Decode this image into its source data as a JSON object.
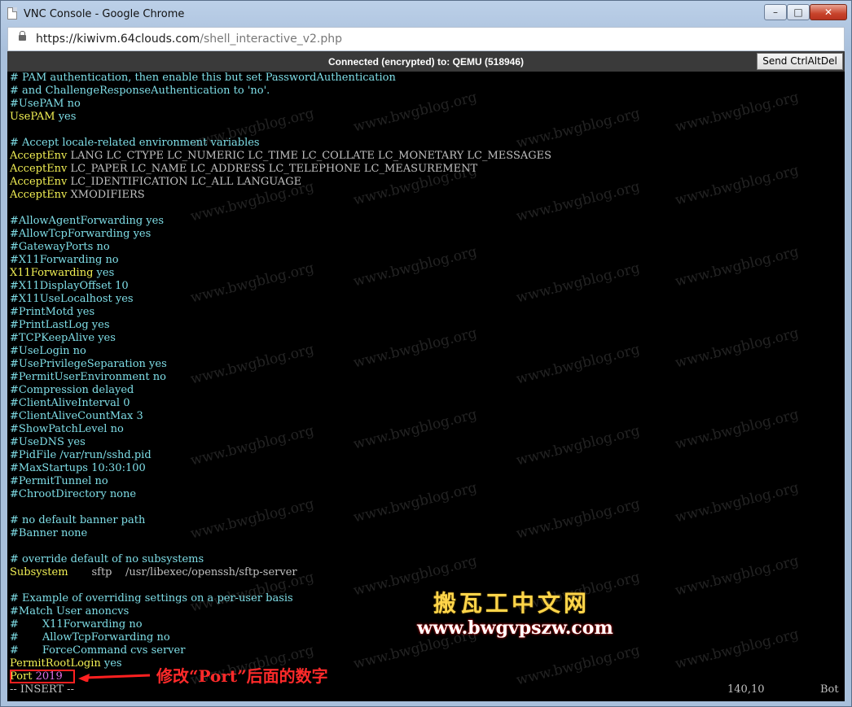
{
  "window": {
    "title": "VNC Console - Google Chrome",
    "min_glyph": "–",
    "max_glyph": "□",
    "close_glyph": "✕"
  },
  "address": {
    "scheme_host": "https://kiwivm.64clouds.com",
    "path": "/shell_interactive_v2.php"
  },
  "vnc": {
    "status": "Connected (encrypted) to: QEMU (518946)",
    "ctrlaltdel_label": "Send CtrlAltDel"
  },
  "terminal": {
    "lines": [
      [
        {
          "t": "# PAM authentication, then enable this but set PasswordAuthentication",
          "c": "cmt"
        }
      ],
      [
        {
          "t": "# and ChallengeResponseAuthentication to 'no'.",
          "c": "cmt"
        }
      ],
      [
        {
          "t": "#UsePAM no",
          "c": "cmt"
        }
      ],
      [
        {
          "t": "UsePAM",
          "c": "yel"
        },
        {
          "t": " yes",
          "c": "cmt"
        }
      ],
      [],
      [
        {
          "t": "# Accept locale-related environment variables",
          "c": "cmt"
        }
      ],
      [
        {
          "t": "AcceptEnv",
          "c": "yel"
        },
        {
          "t": " LANG LC_CTYPE LC_NUMERIC LC_TIME LC_COLLATE LC_MONETARY LC_MESSAGES",
          "c": ""
        }
      ],
      [
        {
          "t": "AcceptEnv",
          "c": "yel"
        },
        {
          "t": " LC_PAPER LC_NAME LC_ADDRESS LC_TELEPHONE LC_MEASUREMENT",
          "c": ""
        }
      ],
      [
        {
          "t": "AcceptEnv",
          "c": "yel"
        },
        {
          "t": " LC_IDENTIFICATION LC_ALL LANGUAGE",
          "c": ""
        }
      ],
      [
        {
          "t": "AcceptEnv",
          "c": "yel"
        },
        {
          "t": " XMODIFIERS",
          "c": ""
        }
      ],
      [],
      [
        {
          "t": "#AllowAgentForwarding yes",
          "c": "cmt"
        }
      ],
      [
        {
          "t": "#AllowTcpForwarding yes",
          "c": "cmt"
        }
      ],
      [
        {
          "t": "#GatewayPorts no",
          "c": "cmt"
        }
      ],
      [
        {
          "t": "#X11Forwarding no",
          "c": "cmt"
        }
      ],
      [
        {
          "t": "X11Forwarding",
          "c": "yel"
        },
        {
          "t": " yes",
          "c": "cmt"
        }
      ],
      [
        {
          "t": "#X11DisplayOffset 10",
          "c": "cmt"
        }
      ],
      [
        {
          "t": "#X11UseLocalhost yes",
          "c": "cmt"
        }
      ],
      [
        {
          "t": "#PrintMotd yes",
          "c": "cmt"
        }
      ],
      [
        {
          "t": "#PrintLastLog yes",
          "c": "cmt"
        }
      ],
      [
        {
          "t": "#TCPKeepAlive yes",
          "c": "cmt"
        }
      ],
      [
        {
          "t": "#UseLogin no",
          "c": "cmt"
        }
      ],
      [
        {
          "t": "#UsePrivilegeSeparation yes",
          "c": "cmt"
        }
      ],
      [
        {
          "t": "#PermitUserEnvironment no",
          "c": "cmt"
        }
      ],
      [
        {
          "t": "#Compression delayed",
          "c": "cmt"
        }
      ],
      [
        {
          "t": "#ClientAliveInterval 0",
          "c": "cmt"
        }
      ],
      [
        {
          "t": "#ClientAliveCountMax 3",
          "c": "cmt"
        }
      ],
      [
        {
          "t": "#ShowPatchLevel no",
          "c": "cmt"
        }
      ],
      [
        {
          "t": "#UseDNS yes",
          "c": "cmt"
        }
      ],
      [
        {
          "t": "#PidFile /var/run/sshd.pid",
          "c": "cmt"
        }
      ],
      [
        {
          "t": "#MaxStartups 10:30:100",
          "c": "cmt"
        }
      ],
      [
        {
          "t": "#PermitTunnel no",
          "c": "cmt"
        }
      ],
      [
        {
          "t": "#ChrootDirectory none",
          "c": "cmt"
        }
      ],
      [],
      [
        {
          "t": "# no default banner path",
          "c": "cmt"
        }
      ],
      [
        {
          "t": "#Banner none",
          "c": "cmt"
        }
      ],
      [],
      [
        {
          "t": "# override default of no subsystems",
          "c": "cmt"
        }
      ],
      [
        {
          "t": "Subsystem",
          "c": "yel"
        },
        {
          "t": "       sftp    /usr/libexec/openssh/sftp-server",
          "c": ""
        }
      ],
      [],
      [
        {
          "t": "# Example of overriding settings on a per-user basis",
          "c": "cmt"
        }
      ],
      [
        {
          "t": "#Match User anoncvs",
          "c": "cmt"
        }
      ],
      [
        {
          "t": "#       X11Forwarding no",
          "c": "cmt"
        }
      ],
      [
        {
          "t": "#       AllowTcpForwarding no",
          "c": "cmt"
        }
      ],
      [
        {
          "t": "#       ForceCommand cvs server",
          "c": "cmt"
        }
      ],
      [
        {
          "t": "PermitRootLogin",
          "c": "yel"
        },
        {
          "t": " yes",
          "c": "cmt"
        }
      ],
      [
        {
          "t": "Port",
          "c": "yel"
        },
        {
          "t": " 2019",
          "c": "pur"
        }
      ],
      [
        {
          "t": "-- INSERT --",
          "c": ""
        }
      ]
    ],
    "cursor_pos": "140,10",
    "scroll_pos": "Bot"
  },
  "watermark": "www.bwgblog.org",
  "annotation": "修改“Port”后面的数字",
  "brand": {
    "name": "搬瓦工中文网",
    "url": "www.bwgvpszw.com"
  }
}
